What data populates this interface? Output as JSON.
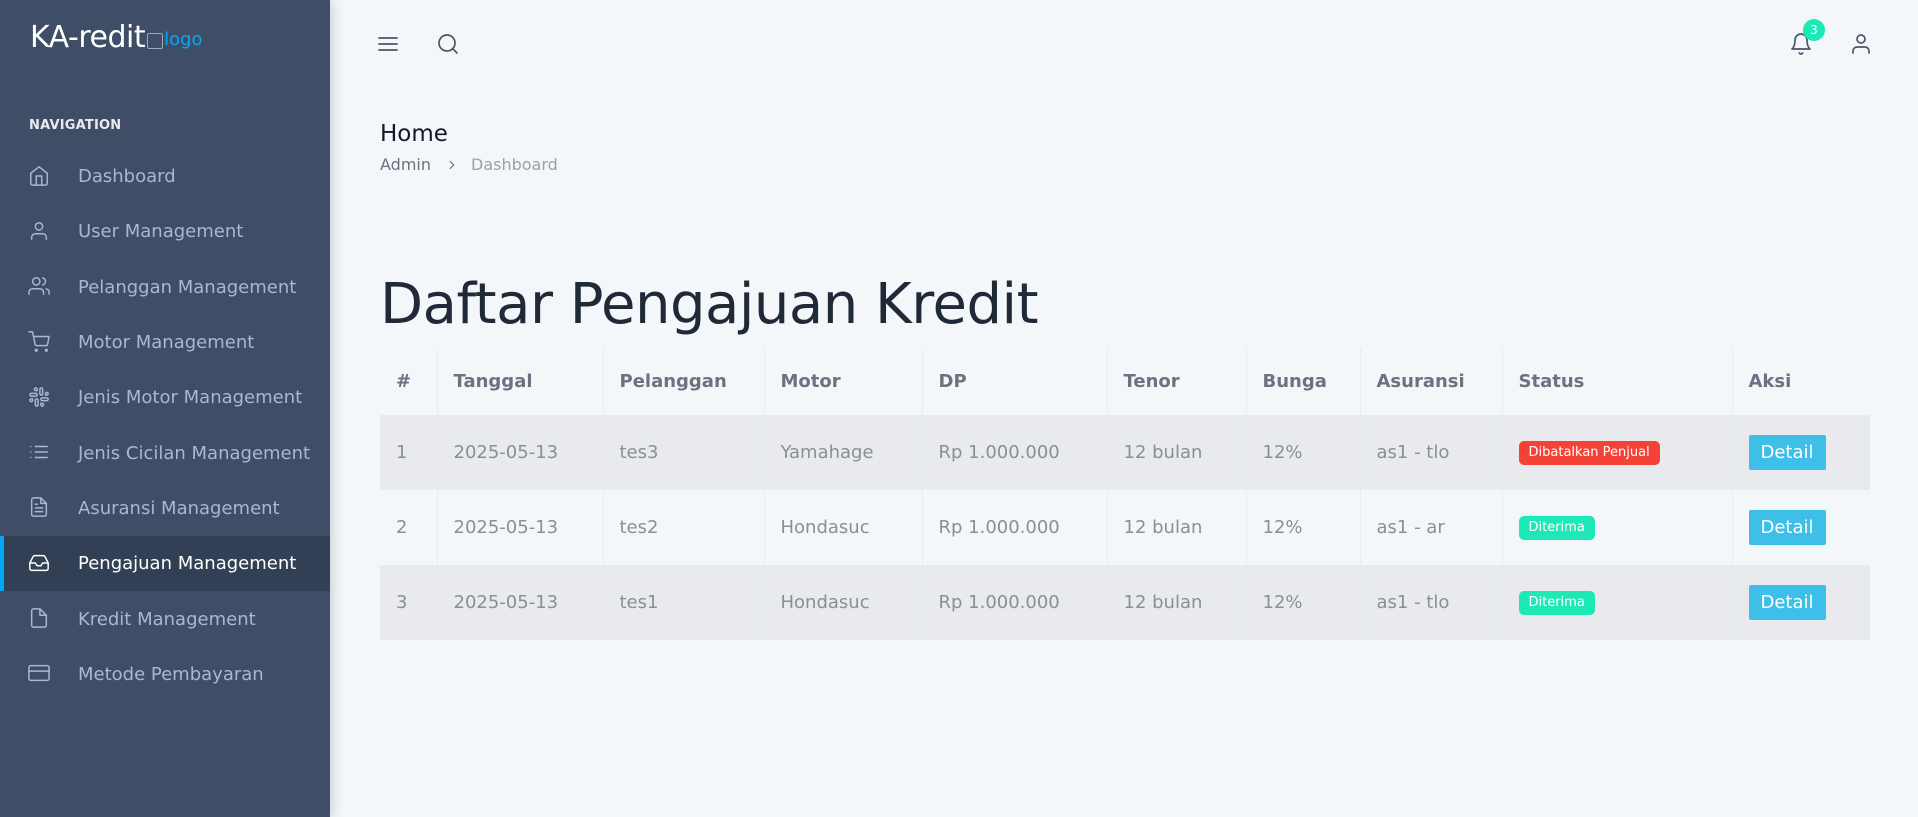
{
  "brand": {
    "text": "KA-redit",
    "logo_alt": "logo"
  },
  "sidebar": {
    "caption": "NAVIGATION",
    "items": [
      {
        "label": "Dashboard",
        "icon": "home-icon"
      },
      {
        "label": "User Management",
        "icon": "user-icon"
      },
      {
        "label": "Pelanggan Management",
        "icon": "users-icon"
      },
      {
        "label": "Motor Management",
        "icon": "cart-icon"
      },
      {
        "label": "Jenis Motor Management",
        "icon": "slack-icon"
      },
      {
        "label": "Jenis Cicilan Management",
        "icon": "list-icon"
      },
      {
        "label": "Asuransi Management",
        "icon": "file-text-icon"
      },
      {
        "label": "Pengajuan Management",
        "icon": "inbox-icon",
        "active": true
      },
      {
        "label": "Kredit Management",
        "icon": "file-icon"
      },
      {
        "label": "Metode Pembayaran",
        "icon": "credit-card-icon"
      }
    ]
  },
  "header": {
    "notification_count": "3"
  },
  "page_header": {
    "title": "Home",
    "breadcrumb": {
      "admin": "Admin",
      "current": "Dashboard"
    }
  },
  "main": {
    "title": "Daftar Pengajuan Kredit",
    "table": {
      "columns": [
        "#",
        "Tanggal",
        "Pelanggan",
        "Motor",
        "DP",
        "Tenor",
        "Bunga",
        "Asuransi",
        "Status",
        "Aksi"
      ],
      "rows": [
        {
          "no": "1",
          "tanggal": "2025-05-13",
          "pelanggan": "tes3",
          "motor": "Yamahage",
          "dp": "Rp 1.000.000",
          "tenor": "12 bulan",
          "bunga": "12%",
          "asuransi": "as1 - tlo",
          "status": "Dibatalkan Penjual",
          "status_color": "#f44236",
          "aksi": "Detail"
        },
        {
          "no": "2",
          "tanggal": "2025-05-13",
          "pelanggan": "tes2",
          "motor": "Hondasuc",
          "dp": "Rp 1.000.000",
          "tenor": "12 bulan",
          "bunga": "12%",
          "asuransi": "as1 - ar",
          "status": "Diterima",
          "status_color": "#1de9b6",
          "aksi": "Detail"
        },
        {
          "no": "3",
          "tanggal": "2025-05-13",
          "pelanggan": "tes1",
          "motor": "Hondasuc",
          "dp": "Rp 1.000.000",
          "tenor": "12 bulan",
          "bunga": "12%",
          "asuransi": "as1 - tlo",
          "status": "Diterima",
          "status_color": "#1de9b6",
          "aksi": "Detail"
        }
      ]
    }
  },
  "colors": {
    "sidebar_bg": "#3f4d67",
    "sidebar_active_bg": "#333f54",
    "accent": "#04a9f5",
    "detail_button": "#3ebfea",
    "success": "#1de9b6",
    "danger": "#f44236"
  }
}
